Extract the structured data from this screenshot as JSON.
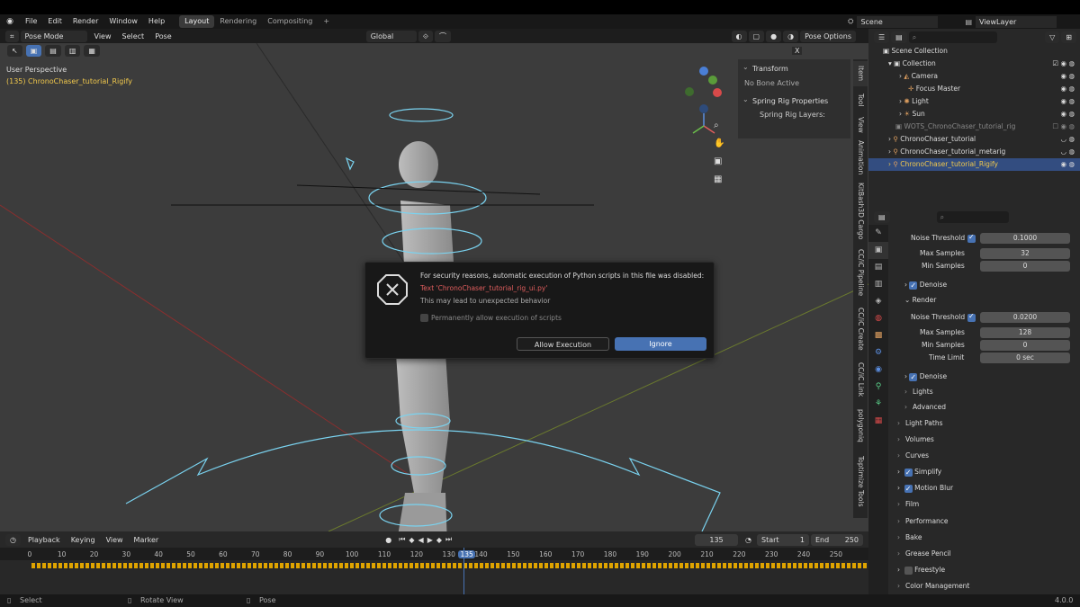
{
  "topbar": {
    "menus": [
      "File",
      "Edit",
      "Render",
      "Window",
      "Help"
    ],
    "tabs": [
      "Layout",
      "Rendering",
      "Compositing"
    ],
    "active_tab": "Layout",
    "plus": "+",
    "scene": "Scene",
    "viewlayer": "ViewLayer"
  },
  "viewport_header": {
    "mode": "Pose Mode",
    "menus": [
      "View",
      "Select",
      "Pose"
    ],
    "orientation": "Global",
    "pose_options": "Pose Options",
    "x_label": "X"
  },
  "viewport": {
    "perspective": "User Perspective",
    "object_info": "(135) ChronoChaser_tutorial_Rigify"
  },
  "npanel": {
    "transform": "Transform",
    "no_bone": "No Bone Active",
    "spring": "Spring Rig Properties",
    "spring_layers": "Spring Rig Layers:"
  },
  "side_tabs": [
    "Item",
    "Tool",
    "View",
    "Animation",
    "KitBash3D Cargo",
    "CC/iC Pipeline",
    "CC/iC Create",
    "CC/iC Link",
    "polygoniq",
    "Toptimize Tools"
  ],
  "dialog": {
    "title": "For security reasons, automatic execution of Python scripts in this file was disabled:",
    "script": "Text 'ChronoChaser_tutorial_rig_ui.py'",
    "warning": "This may lead to unexpected behavior",
    "checkbox": "Permanently allow execution of scripts",
    "allow": "Allow Execution",
    "ignore": "Ignore"
  },
  "timeline": {
    "menus": [
      "Playback",
      "Keying",
      "View",
      "Marker"
    ],
    "current_frame": "135",
    "start_label": "Start",
    "start": "1",
    "end_label": "End",
    "end": "250",
    "ticks": [
      "0",
      "10",
      "20",
      "30",
      "40",
      "50",
      "60",
      "70",
      "80",
      "90",
      "100",
      "110",
      "120",
      "130",
      "135",
      "140",
      "150",
      "160",
      "170",
      "180",
      "190",
      "200",
      "210",
      "220",
      "230",
      "240",
      "250"
    ]
  },
  "statusbar": {
    "select": "Select",
    "rotate": "Rotate View",
    "pose": "Pose",
    "version": "4.0.0"
  },
  "outliner": {
    "rows": [
      "Scene Collection",
      "Collection",
      "Camera",
      "Focus Master",
      "Light",
      "Sun",
      "WOTS_ChronoChaser_tutorial_rig",
      "ChronoChaser_tutorial",
      "ChronoChaser_tutorial_metarig",
      "ChronoChaser_tutorial_Rigify"
    ]
  },
  "props": {
    "noise1": "Noise Threshold",
    "noise1_val": "0.1000",
    "max1": "Max Samples",
    "max1_val": "32",
    "min1": "Min Samples",
    "min1_val": "0",
    "denoise1": "Denoise",
    "render": "Render",
    "noise2": "Noise Threshold",
    "noise2_val": "0.0200",
    "max2": "Max Samples",
    "max2_val": "128",
    "min2": "Min Samples",
    "min2_val": "0",
    "time": "Time Limit",
    "time_val": "0 sec",
    "denoise2": "Denoise",
    "sections": [
      "Lights",
      "Advanced",
      "Light Paths",
      "Volumes",
      "Curves",
      "Simplify",
      "Motion Blur",
      "Film",
      "Performance",
      "Bake",
      "Grease Pencil",
      "Freestyle",
      "Color Management"
    ]
  },
  "colors": {
    "accent": "#4772b3",
    "rig_lines": "#7ad3f0",
    "object_text": "#f2c94c",
    "error_text": "#e05d5d"
  }
}
